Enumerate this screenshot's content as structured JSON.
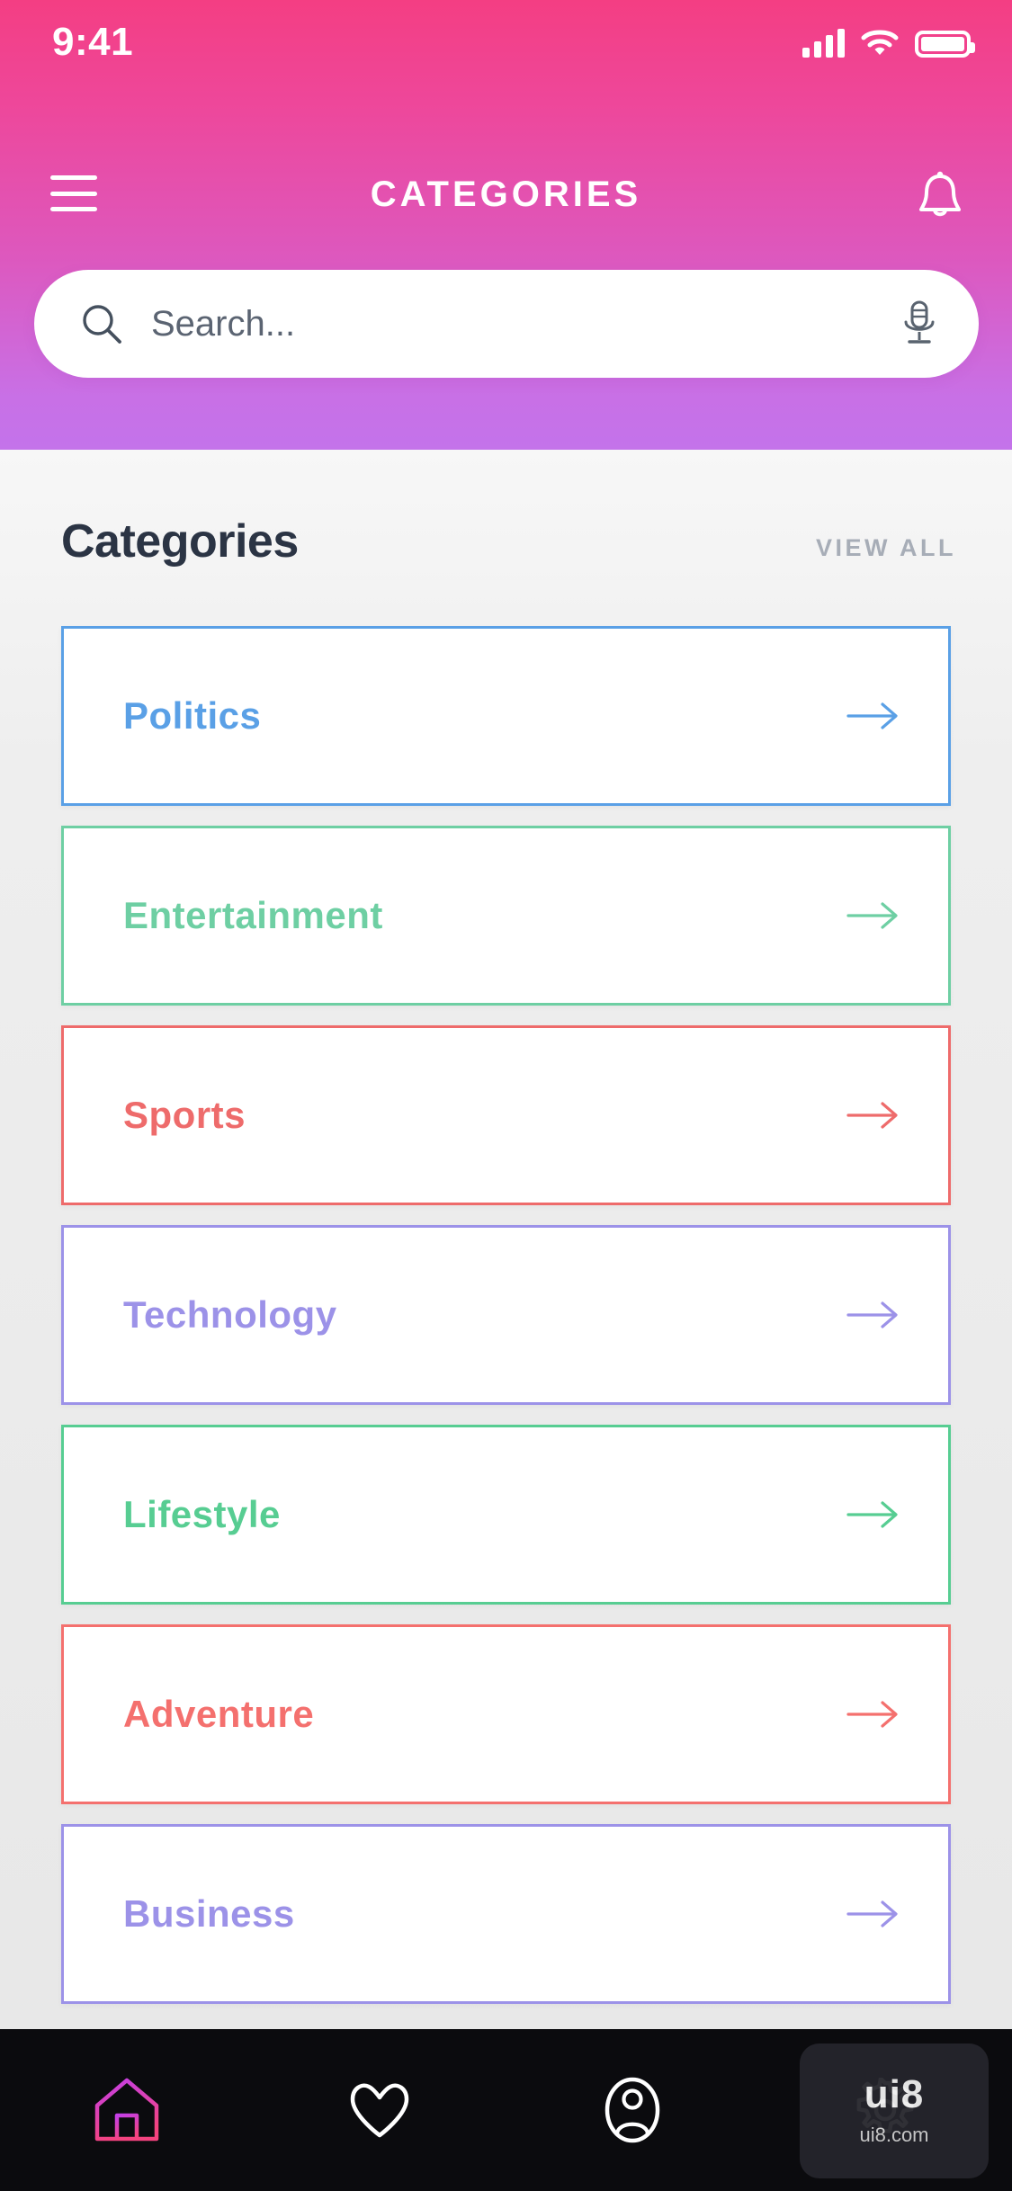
{
  "status_bar": {
    "time": "9:41",
    "signal_icon": "cellular-signal-icon",
    "wifi_icon": "wifi-icon",
    "battery_icon": "battery-full-icon"
  },
  "header": {
    "menu_icon": "hamburger-menu-icon",
    "title": "CATEGORIES",
    "notification_icon": "bell-icon",
    "gradient_from": "#F43E83",
    "gradient_to": "#C274EC"
  },
  "search": {
    "placeholder": "Search...",
    "value": "",
    "search_icon": "search-icon",
    "mic_icon": "microphone-icon"
  },
  "section": {
    "title": "Categories",
    "view_all_label": "VIEW ALL"
  },
  "categories": [
    {
      "label": "Politics",
      "color": "#5AA0E6",
      "arrow_icon": "arrow-right-icon"
    },
    {
      "label": "Entertainment",
      "color": "#6ECFA3",
      "arrow_icon": "arrow-right-icon"
    },
    {
      "label": "Sports",
      "color": "#EE6B6B",
      "arrow_icon": "arrow-right-icon"
    },
    {
      "label": "Technology",
      "color": "#9C92E8",
      "arrow_icon": "arrow-right-icon"
    },
    {
      "label": "Lifestyle",
      "color": "#57CD92",
      "arrow_icon": "arrow-right-icon"
    },
    {
      "label": "Adventure",
      "color": "#F4706E",
      "arrow_icon": "arrow-right-icon"
    },
    {
      "label": "Business",
      "color": "#9C92E8",
      "arrow_icon": "arrow-right-icon"
    }
  ],
  "bottom_nav": {
    "items": [
      {
        "icon": "home-icon",
        "active": true
      },
      {
        "icon": "heart-icon",
        "active": false
      },
      {
        "icon": "profile-icon",
        "active": false
      },
      {
        "icon": "settings-gear-icon",
        "active": false
      }
    ],
    "active_gradient_from": "#C43FE8",
    "active_gradient_to": "#F4437F",
    "background": "#0b0b0e"
  },
  "watermark": {
    "top": "ui8",
    "bottom": "ui8.com"
  }
}
